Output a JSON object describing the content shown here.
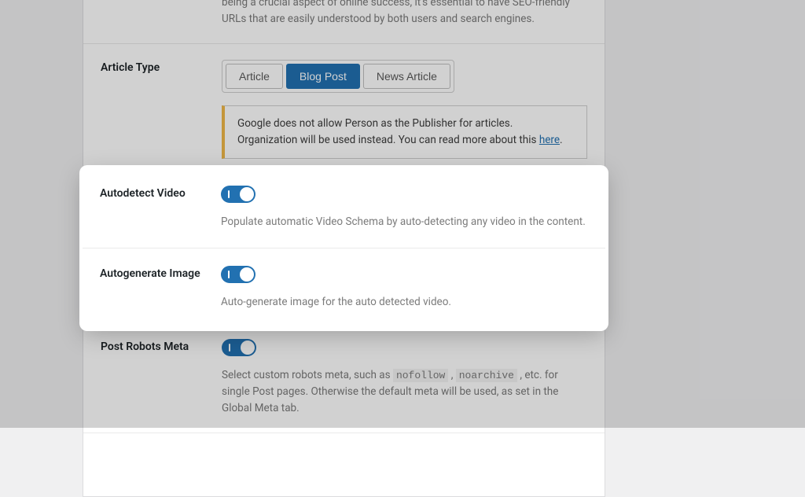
{
  "intro": {
    "tail": "being a crucial aspect of online success, it’s essential to have SEO-friendly URLs that are easily understood by both users and search engines."
  },
  "article_type": {
    "label": "Article Type",
    "options": [
      "Article",
      "Blog Post",
      "News Article"
    ],
    "notice_pre": "Google does not allow Person as the Publisher for articles. Organization will be used instead. You can read more about this ",
    "notice_link": "here",
    "notice_post": "."
  },
  "autodetect_video": {
    "label": "Autodetect Video",
    "desc": "Populate automatic Video Schema by auto-detecting any video in the content."
  },
  "autogenerate_image": {
    "label": "Autogenerate Image",
    "desc": "Auto-generate image for the auto detected video."
  },
  "post_robots": {
    "label": "Post Robots Meta",
    "desc_pre": "Select custom robots meta, such as ",
    "code1": "nofollow",
    "desc_mid": " , ",
    "code2": "noarchive",
    "desc_post": " , etc. for single Post pages. Otherwise the default meta will be used, as set in the Global Meta tab."
  }
}
